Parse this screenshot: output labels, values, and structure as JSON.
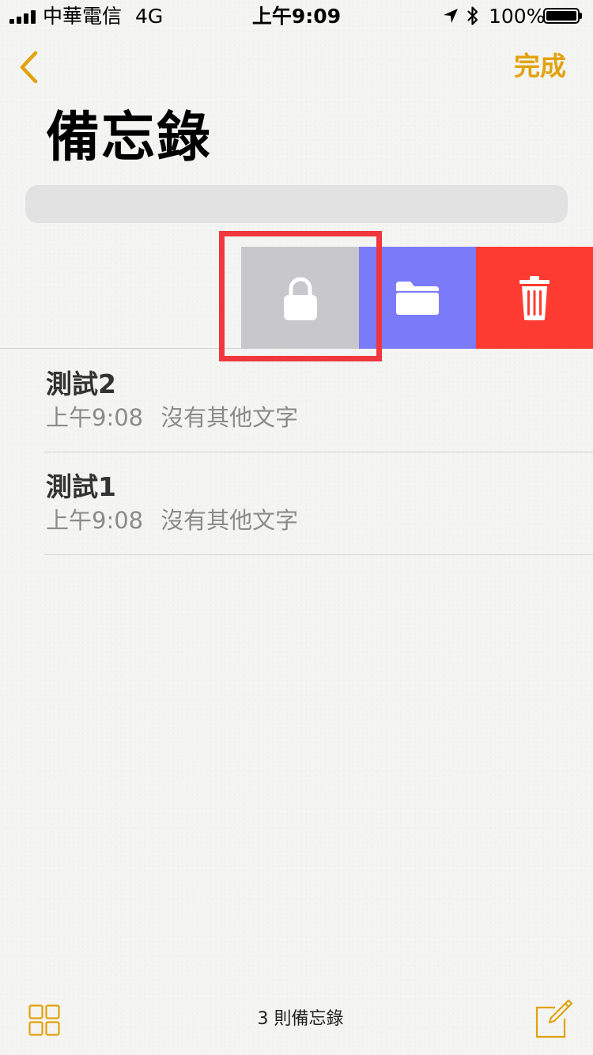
{
  "status_bar": {
    "carrier": "中華電信",
    "network": "4G",
    "time": "上午9:09",
    "battery": "100%",
    "battery_level": 1.0,
    "icons": [
      "signal-bars-icon",
      "location-arrow-icon",
      "bluetooth-icon",
      "battery-icon"
    ]
  },
  "nav": {
    "back_icon": "chevron-left-icon",
    "done_label": "完成"
  },
  "title": "備忘錄",
  "swipe_actions": [
    {
      "name": "lock",
      "icon": "lock-icon",
      "color": "#c7c7cc"
    },
    {
      "name": "move",
      "icon": "folder-icon",
      "color": "#7b7bfa"
    },
    {
      "name": "delete",
      "icon": "trash-icon",
      "color": "#fe3b31"
    }
  ],
  "notes": [
    {
      "title": "測試2",
      "time": "上午9:08",
      "preview": "沒有其他文字"
    },
    {
      "title": "測試1",
      "time": "上午9:08",
      "preview": "沒有其他文字"
    }
  ],
  "toolbar": {
    "note_count": "3 則備忘錄",
    "left_icon": "grid-icon",
    "right_icon": "compose-icon"
  },
  "colors": {
    "accent": "#e2a20c",
    "highlight": "#f0363f",
    "lock_action": "#c7c7cc",
    "move_action": "#7b7bfa",
    "delete_action": "#fe3b31"
  }
}
